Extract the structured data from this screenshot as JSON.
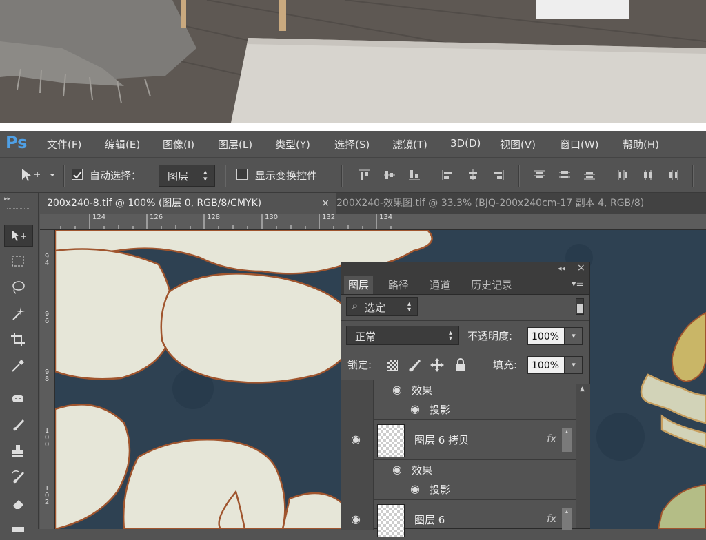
{
  "app": {
    "logo": "Ps"
  },
  "menu": [
    "文件(F)",
    "编辑(E)",
    "图像(I)",
    "图层(L)",
    "类型(Y)",
    "选择(S)",
    "滤镜(T)",
    "3D(D)",
    "视图(V)",
    "窗口(W)",
    "帮助(H)"
  ],
  "options": {
    "auto_select_label": "自动选择：",
    "auto_select_value": "图层",
    "show_transform_label": "显示变换控件"
  },
  "tabs": [
    {
      "label": "200x240-8.tif @ 100% (图层 0, RGB/8/CMYK)",
      "close": "×"
    },
    {
      "label": "200X240-效果图.tif @ 33.3% (BJQ-200x240cm-17 副本 4, RGB/8)"
    }
  ],
  "ruler": {
    "h": [
      "124",
      "126",
      "128",
      "130",
      "132",
      "134"
    ],
    "v": [
      [
        "9",
        "4"
      ],
      [
        "9",
        "6"
      ],
      [
        "9",
        "8"
      ],
      [
        "1",
        "0",
        "0"
      ],
      [
        "1",
        "0",
        "2"
      ]
    ]
  },
  "layers_panel": {
    "collapse_glyph": "◂◂",
    "close_glyph": "×",
    "tabs": [
      "图层",
      "路径",
      "通道",
      "历史记录"
    ],
    "filter_label": "选定",
    "blend_mode": "正常",
    "opacity_label": "不透明度:",
    "opacity_value": "100%",
    "lock_label": "锁定:",
    "fill_label": "填充:",
    "fill_value": "100%",
    "rows": {
      "effects_label": "效果",
      "drop_shadow_label": "投影",
      "layer6_copy_name": "图层 6 拷贝",
      "layer6_name": "图层 6",
      "fx": "fx"
    }
  },
  "colors": {
    "ps_blue": "#4fa0e6",
    "panel_bg": "#535353",
    "canvas_bg": "#2f4253"
  }
}
